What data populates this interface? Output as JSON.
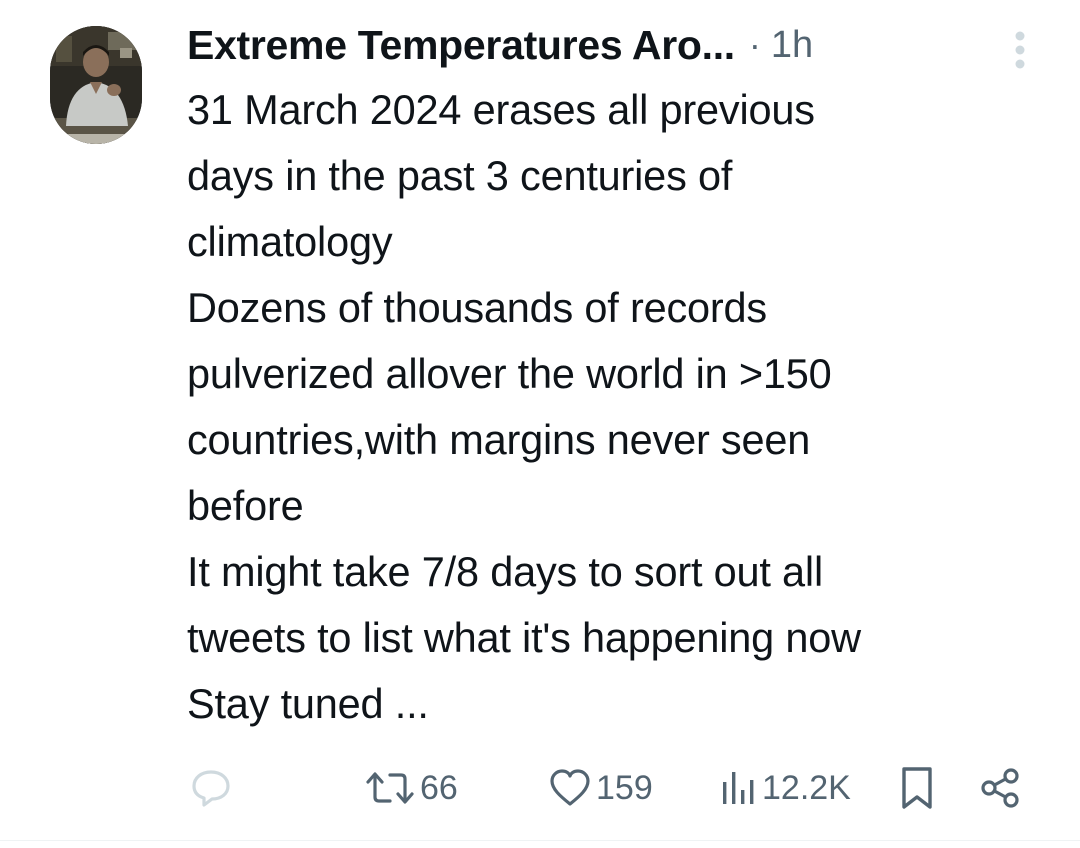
{
  "tweet": {
    "author_name": "Extreme Temperatures Aro...",
    "separator": "·",
    "time": "1h",
    "text_lines": [
      "31 March 2024 erases all previous",
      "days in the past 3 centuries of",
      "climatology",
      "Dozens of thousands of records",
      "pulverized allover the world in >150",
      "countries,with margins never seen",
      "before",
      "It might take 7/8 days to sort out all",
      "tweets to list what it's happening now",
      "Stay tuned ..."
    ],
    "actions": {
      "reply_icon": "reply-icon",
      "retweet_icon": "retweet-icon",
      "retweet_count": "66",
      "like_icon": "heart-icon",
      "like_count": "159",
      "views_icon": "views-chart-icon",
      "views_count": "12.2K",
      "bookmark_icon": "bookmark-icon",
      "share_icon": "share-icon"
    }
  },
  "colors": {
    "text": "#0f1419",
    "secondary": "#536471",
    "reply_icon": "#cfd9de"
  }
}
